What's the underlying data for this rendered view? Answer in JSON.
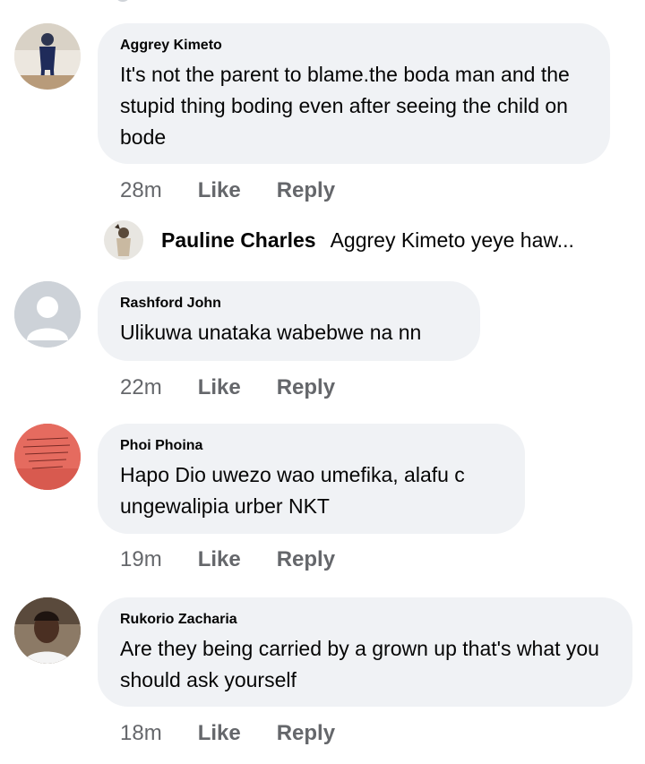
{
  "comments": [
    {
      "author": "Aggrey Kimeto",
      "text": "It's not the parent to blame.the boda man and the stupid thing boding even after seeing the child on bode",
      "time": "28m",
      "like": "Like",
      "reply": "Reply"
    },
    {
      "author": "Rashford John",
      "text": "Ulikuwa unataka  wabebwe na nn",
      "time": "22m",
      "like": "Like",
      "reply": "Reply"
    },
    {
      "author": "Phoi Phoina",
      "text": "Hapo Dio uwezo wao umefika, alafu c ungewalipia urber NKT",
      "time": "19m",
      "like": "Like",
      "reply": "Reply"
    },
    {
      "author": "Rukorio Zacharia",
      "text": "Are they being carried by a grown up that's what you should ask yourself",
      "time": "18m",
      "like": "Like",
      "reply": "Reply"
    }
  ],
  "reply_preview": {
    "author": "Pauline Charles",
    "text": "Aggrey Kimeto yeye haw..."
  },
  "colors": {
    "bubble": "#f0f2f5",
    "meta_text": "#65676b",
    "text": "#050505"
  }
}
